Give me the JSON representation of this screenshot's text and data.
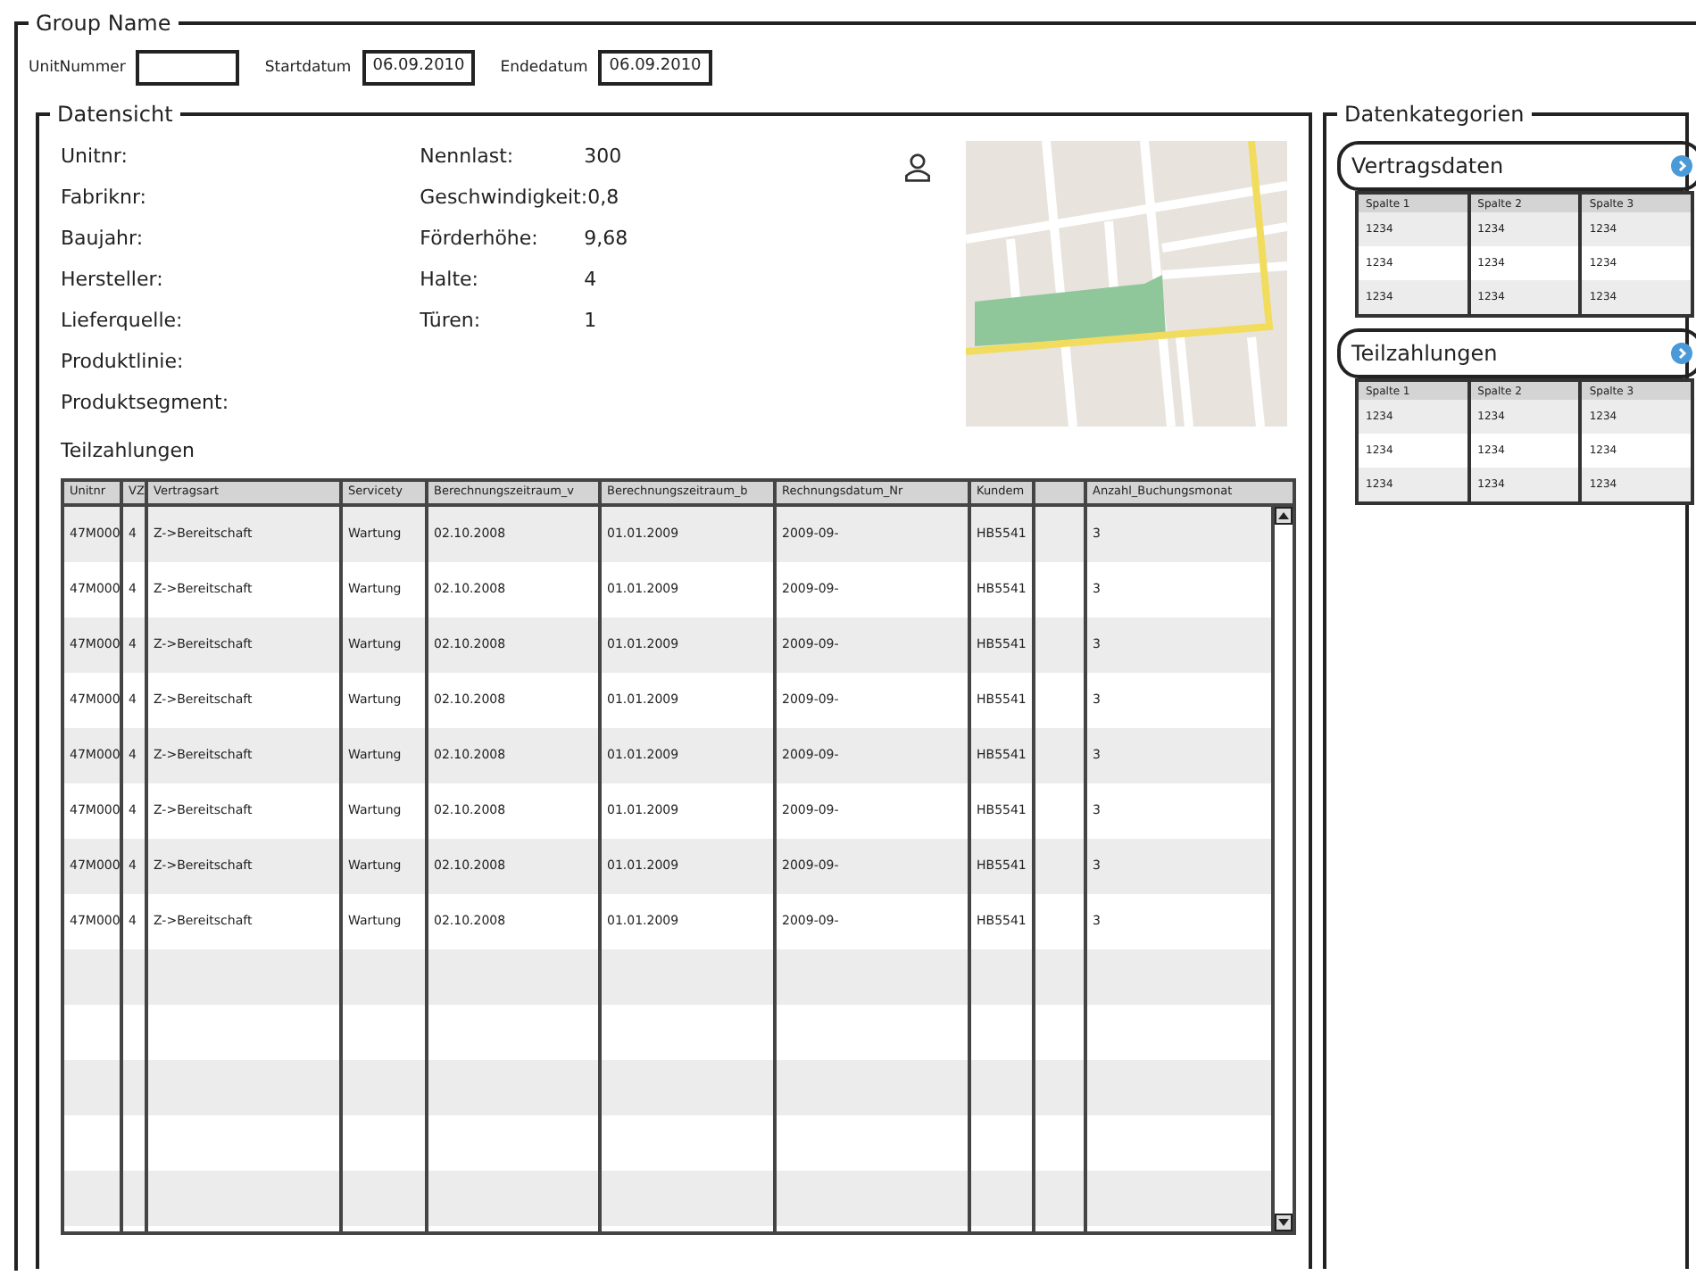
{
  "group": {
    "title": "Group Name"
  },
  "filters": [
    {
      "label": "UnitNummer"
    },
    {
      "label": "Startdatum",
      "value": "06.09.2010"
    },
    {
      "label": "Endedatum",
      "value": "06.09.2010"
    }
  ],
  "datensicht": {
    "title": "Datensicht",
    "left_fields": [
      {
        "label": "Unitnr:"
      },
      {
        "label": "Fabriknr:"
      },
      {
        "label": "Baujahr:"
      },
      {
        "label": "Hersteller:"
      },
      {
        "label": "Lieferquelle:"
      },
      {
        "label": "Produktlinie:"
      },
      {
        "label": "Produktsegment:"
      }
    ],
    "right_fields": [
      {
        "label": "Nennlast:",
        "value": "300"
      },
      {
        "label": "Geschwindigkeit:",
        "value": "0,8"
      },
      {
        "label": "Förderhöhe:",
        "value": "9,68"
      },
      {
        "label": "Halte:",
        "value": "4"
      },
      {
        "label": "Türen:",
        "value": "1"
      }
    ],
    "table_title": "Teilzahlungen",
    "table": {
      "columns": [
        {
          "label": "Unitnr"
        },
        {
          "label": "VZ"
        },
        {
          "label": "Vertragsart"
        },
        {
          "label": "Servicety"
        },
        {
          "label": "Berechnungszeitraum_v"
        },
        {
          "label": "Berechnungszeitraum_b"
        },
        {
          "label": "Rechnungsdatum_Nr"
        },
        {
          "label": "Kundem"
        },
        {
          "kind": "empty"
        },
        {
          "label": "Anzahl_Buchungsmonat"
        }
      ],
      "rows": [
        [
          "47M000",
          "4",
          "Z->Bereitschaft",
          "Wartung",
          "02.10.2008",
          "01.01.2009",
          "2009-09-",
          "HB5541",
          "3"
        ],
        [
          "47M000",
          "4",
          "Z->Bereitschaft",
          "Wartung",
          "02.10.2008",
          "01.01.2009",
          "2009-09-",
          "HB5541",
          "3"
        ],
        [
          "47M000",
          "4",
          "Z->Bereitschaft",
          "Wartung",
          "02.10.2008",
          "01.01.2009",
          "2009-09-",
          "HB5541",
          "3"
        ],
        [
          "47M000",
          "4",
          "Z->Bereitschaft",
          "Wartung",
          "02.10.2008",
          "01.01.2009",
          "2009-09-",
          "HB5541",
          "3"
        ],
        [
          "47M000",
          "4",
          "Z->Bereitschaft",
          "Wartung",
          "02.10.2008",
          "01.01.2009",
          "2009-09-",
          "HB5541",
          "3"
        ],
        [
          "47M000",
          "4",
          "Z->Bereitschaft",
          "Wartung",
          "02.10.2008",
          "01.01.2009",
          "2009-09-",
          "HB5541",
          "3"
        ],
        [
          "47M000",
          "4",
          "Z->Bereitschaft",
          "Wartung",
          "02.10.2008",
          "01.01.2009",
          "2009-09-",
          "HB5541",
          "3"
        ],
        [
          "47M000",
          "4",
          "Z->Bereitschaft",
          "Wartung",
          "02.10.2008",
          "01.01.2009",
          "2009-09-",
          "HB5541",
          "3"
        ]
      ]
    }
  },
  "datenkategorien": {
    "title": "Datenkategorien",
    "panels": [
      {
        "title": "Vertragsdaten",
        "columns": [
          "Spalte 1",
          "Spalte 2",
          "Spalte 3"
        ],
        "rows": [
          [
            "1234",
            "1234",
            "1234"
          ],
          [
            "1234",
            "1234",
            "1234"
          ],
          [
            "1234",
            "1234",
            "1234"
          ]
        ]
      },
      {
        "title": "Teilzahlungen",
        "columns": [
          "Spalte 1",
          "Spalte 2",
          "Spalte 3"
        ],
        "rows": [
          [
            "1234",
            "1234",
            "1234"
          ],
          [
            "1234",
            "1234",
            "1234"
          ],
          [
            "1234",
            "1234",
            "1234"
          ]
        ]
      }
    ]
  }
}
